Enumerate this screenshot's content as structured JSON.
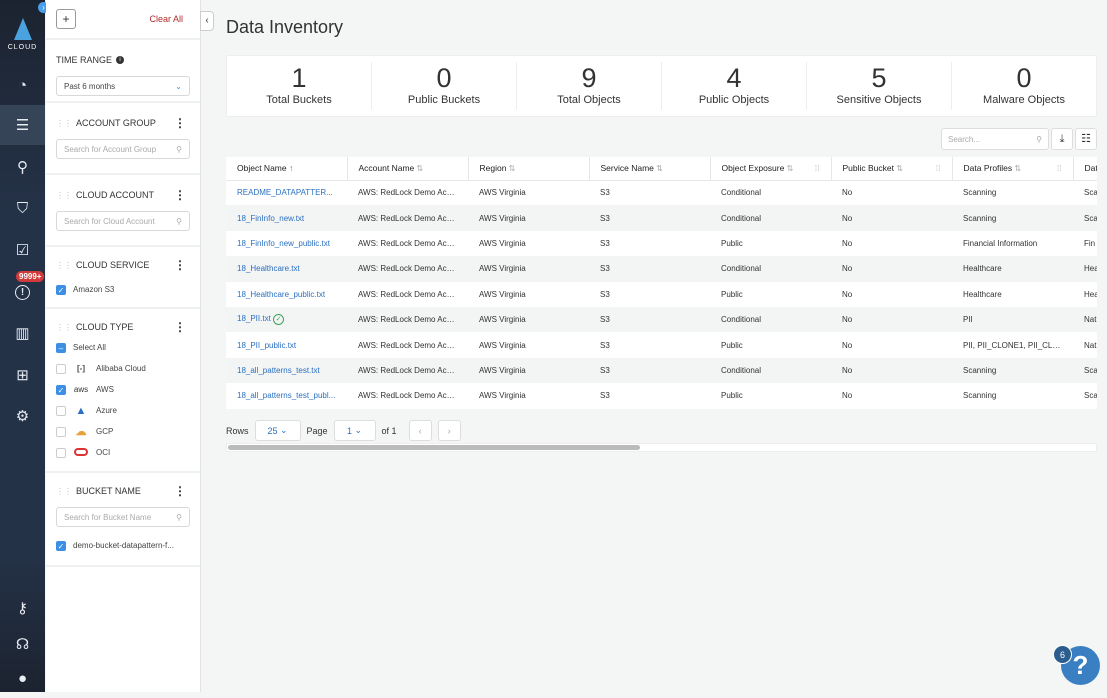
{
  "nav": {
    "logo_text": "CLOUD",
    "alert_badge": "9999+",
    "items": [
      "dashboard-icon",
      "inventory-icon",
      "investigate-icon",
      "policies-icon",
      "compliance-icon",
      "alerts-icon",
      "compute-icon",
      "network-icon",
      "settings-icon",
      "tools-icon",
      "support-icon",
      "profile-icon"
    ]
  },
  "filters": {
    "add_label": "+",
    "clear_all": "Clear All",
    "time_range": {
      "title": "TIME RANGE",
      "value": "Past 6 months"
    },
    "account_group": {
      "title": "ACCOUNT GROUP",
      "placeholder": "Search for Account Group"
    },
    "cloud_account": {
      "title": "CLOUD ACCOUNT",
      "placeholder": "Search for Cloud Account"
    },
    "cloud_service": {
      "title": "CLOUD SERVICE",
      "options": [
        {
          "label": "Amazon S3",
          "checked": true
        }
      ]
    },
    "cloud_type": {
      "title": "CLOUD TYPE",
      "select_all": "Select All",
      "options": [
        {
          "label": "Alibaba Cloud",
          "checked": false,
          "icon": "alibaba-icon"
        },
        {
          "label": "AWS",
          "checked": true,
          "icon": "aws-icon"
        },
        {
          "label": "Azure",
          "checked": false,
          "icon": "azure-icon"
        },
        {
          "label": "GCP",
          "checked": false,
          "icon": "gcp-icon"
        },
        {
          "label": "OCI",
          "checked": false,
          "icon": "oci-icon"
        }
      ]
    },
    "bucket_name": {
      "title": "BUCKET NAME",
      "placeholder": "Search for Bucket Name",
      "options": [
        {
          "label": "demo-bucket-datapattern-f...",
          "checked": true
        }
      ]
    }
  },
  "main": {
    "title": "Data Inventory",
    "stats": [
      {
        "value": "1",
        "label": "Total Buckets"
      },
      {
        "value": "0",
        "label": "Public Buckets"
      },
      {
        "value": "9",
        "label": "Total Objects"
      },
      {
        "value": "4",
        "label": "Public Objects"
      },
      {
        "value": "5",
        "label": "Sensitive Objects"
      },
      {
        "value": "0",
        "label": "Malware Objects"
      }
    ],
    "search_placeholder": "Search...",
    "columns": [
      "Object Name",
      "Account Name",
      "Region",
      "Service Name",
      "Object Exposure",
      "Public Bucket",
      "Data Profiles",
      "Dat"
    ],
    "rows": [
      [
        "README_DATAPATTER...",
        "AWS: RedLock Demo Acc...",
        "AWS Virginia",
        "S3",
        "Conditional",
        "No",
        "Scanning",
        "Sca"
      ],
      [
        "18_FinInfo_new.txt",
        "AWS: RedLock Demo Acc...",
        "AWS Virginia",
        "S3",
        "Conditional",
        "No",
        "Scanning",
        "Sca"
      ],
      [
        "18_FinInfo_new_public.txt",
        "AWS: RedLock Demo Acc...",
        "AWS Virginia",
        "S3",
        "Public",
        "No",
        "Financial Information",
        "Fin"
      ],
      [
        "18_Healthcare.txt",
        "AWS: RedLock Demo Acc...",
        "AWS Virginia",
        "S3",
        "Conditional",
        "No",
        "Healthcare",
        "Hea"
      ],
      [
        "18_Healthcare_public.txt",
        "AWS: RedLock Demo Acc...",
        "AWS Virginia",
        "S3",
        "Public",
        "No",
        "Healthcare",
        "Hea"
      ],
      [
        "18_PII.txt",
        "AWS: RedLock Demo Acc...",
        "AWS Virginia",
        "S3",
        "Conditional",
        "No",
        "PII",
        "Nat"
      ],
      [
        "18_PII_public.txt",
        "AWS: RedLock Demo Acc...",
        "AWS Virginia",
        "S3",
        "Public",
        "No",
        "PII, PII_CLONE1, PII_CLO...",
        "Nat"
      ],
      [
        "18_all_patterns_test.txt",
        "AWS: RedLock Demo Acc...",
        "AWS Virginia",
        "S3",
        "Conditional",
        "No",
        "Scanning",
        "Sca"
      ],
      [
        "18_all_patterns_test_publ...",
        "AWS: RedLock Demo Acc...",
        "AWS Virginia",
        "S3",
        "Public",
        "No",
        "Scanning",
        "Sca"
      ]
    ],
    "pager": {
      "rows_label": "Rows",
      "rows_value": "25",
      "page_label": "Page",
      "page_value": "1",
      "of_label": "of 1"
    }
  },
  "help": {
    "count": "6",
    "label": "?"
  },
  "colors": {
    "accent": "#3d8fe6",
    "link": "#2a70c2",
    "nav_bg": "#243247",
    "clear_all": "#b02a2a"
  }
}
